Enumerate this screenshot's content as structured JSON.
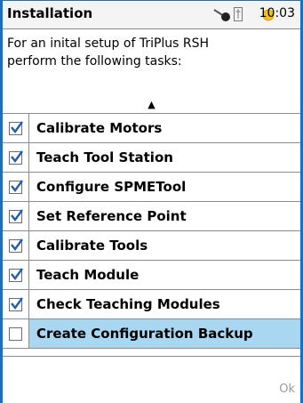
{
  "header": {
    "title": "Installation",
    "time": "10:03",
    "icons": [
      "tool-status-icon",
      "usb-icon",
      "status-indicator-icon"
    ],
    "status_color": "#f5c400"
  },
  "intro": {
    "line1": "For an inital setup of TriPlus RSH",
    "line2": "perform the following tasks:"
  },
  "tasks": [
    {
      "label": "Calibrate Motors",
      "checked": true
    },
    {
      "label": "Teach Tool Station",
      "checked": true
    },
    {
      "label": "Configure SPMETool",
      "checked": true
    },
    {
      "label": "Set Reference Point",
      "checked": true
    },
    {
      "label": "Calibrate Tools",
      "checked": true
    },
    {
      "label": "Teach Module",
      "checked": true
    },
    {
      "label": "Check Teaching Modules",
      "checked": true
    },
    {
      "label": "Create Configuration Backup",
      "checked": false,
      "selected": true
    }
  ],
  "footer": {
    "ok_label": "Ok"
  },
  "colors": {
    "accent": "#1e6fb8",
    "selection": "#a9d6f0",
    "check": "#1f5fae"
  }
}
